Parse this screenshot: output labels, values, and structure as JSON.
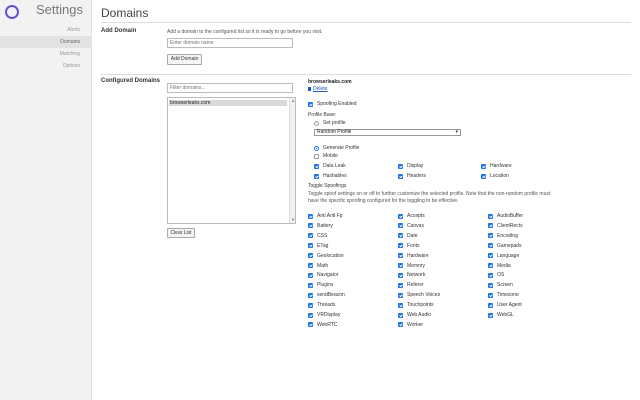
{
  "app": {
    "title": "Settings"
  },
  "sidebar": {
    "items": [
      {
        "label": "Alerts",
        "active": false
      },
      {
        "label": "Domains",
        "active": true
      },
      {
        "label": "Matching",
        "active": false
      },
      {
        "label": "Options",
        "active": false
      }
    ]
  },
  "main": {
    "title": "Domains",
    "add_domain": {
      "label": "Add Domain",
      "hint": "Add a domain to the configured list so it is ready to go before you visit.",
      "placeholder": "Enter domain name",
      "button": "Add Domain"
    },
    "configured": {
      "label": "Configured Domains",
      "filter_placeholder": "Filter domains...",
      "domains": [
        "browserleaks.com"
      ],
      "clear_button": "Clear List"
    },
    "detail": {
      "domain": "browserleaks.com",
      "delete_label": "Delete",
      "spoofing_enabled": "Spoofing Enabled",
      "profile_base": "Profile Base:",
      "set_profile": "Set profile",
      "profile_select": "Random Profile",
      "generate_profile": "Generate Profile",
      "mobile": "Mobile",
      "options": [
        "Data Leak",
        "Display",
        "Hardware",
        "Hashables",
        "Headers",
        "Location"
      ],
      "toggle_title": "Toggle Spoofings",
      "toggle_desc": "Toggle spoof settings on or off to further customize the selected profile. Note that the non-random profile must have the specific spoofing configured for the toggling to be effective.",
      "spoofings": [
        [
          "Anti Anti Fp",
          "Accepts",
          "AudioBuffer"
        ],
        [
          "Battery",
          "Canvas",
          "ClientRects"
        ],
        [
          "CSS",
          "Date",
          "Encoding"
        ],
        [
          "ETag",
          "Fonts",
          "Gamepads"
        ],
        [
          "Geolocation",
          "Hardware",
          "Language"
        ],
        [
          "Math",
          "Memory",
          "Media"
        ],
        [
          "Navigator",
          "Network",
          "OS"
        ],
        [
          "Plugins",
          "Referer",
          "Screen"
        ],
        [
          "sendBeacon",
          "Speech Voices",
          "Timezone"
        ],
        [
          "Threads",
          "Touchpoints",
          "User Agent"
        ],
        [
          "VRDisplay",
          "Web Audio",
          "WebGL"
        ],
        [
          "WebRTC",
          "Worker",
          ""
        ]
      ]
    }
  },
  "colors": {
    "accent": "#1a73e8",
    "logo": "#6b4fd8",
    "link": "#1a56c4"
  }
}
